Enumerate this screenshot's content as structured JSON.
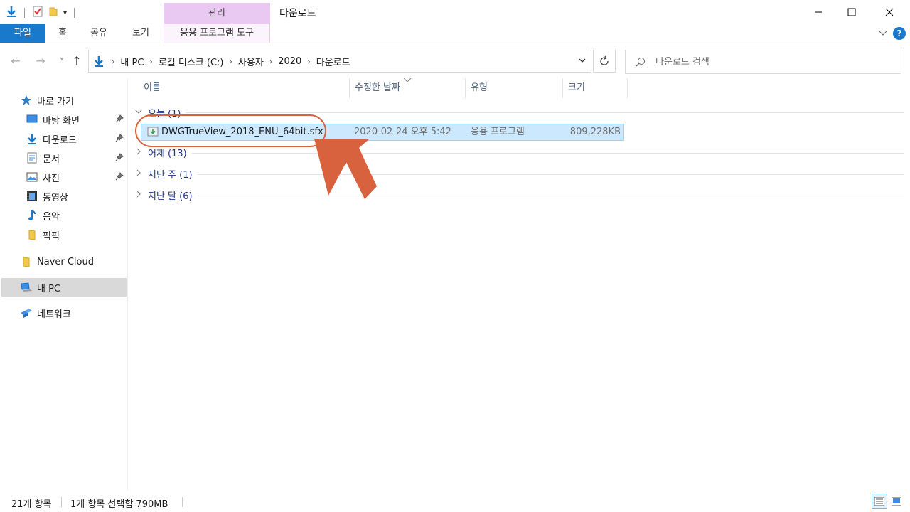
{
  "window": {
    "title": "다운로드",
    "context_tab_label": "관리"
  },
  "ribbon": {
    "tabs": [
      "파일",
      "홈",
      "공유",
      "보기",
      "응용 프로그램 도구"
    ],
    "help_label": "?"
  },
  "address": {
    "crumbs": [
      "내 PC",
      "로컬 디스크 (C:)",
      "사용자",
      "2020",
      "다운로드"
    ]
  },
  "search": {
    "placeholder": "다운로드 검색"
  },
  "sidebar": {
    "quick_access": "바로 가기",
    "items": [
      {
        "label": "바탕 화면",
        "icon": "desktop-icon",
        "pinned": true
      },
      {
        "label": "다운로드",
        "icon": "download-icon",
        "pinned": true
      },
      {
        "label": "문서",
        "icon": "document-icon",
        "pinned": true
      },
      {
        "label": "사진",
        "icon": "pictures-icon",
        "pinned": true
      },
      {
        "label": "동영상",
        "icon": "video-icon",
        "pinned": false
      },
      {
        "label": "음악",
        "icon": "music-icon",
        "pinned": false
      },
      {
        "label": "픽픽",
        "icon": "folder-icon",
        "pinned": false
      }
    ],
    "naver_cloud": "Naver Cloud",
    "this_pc": "내 PC",
    "network": "네트워크"
  },
  "columns": [
    "이름",
    "수정한 날짜",
    "유형",
    "크기"
  ],
  "groups": [
    {
      "label": "오늘 (1)",
      "expanded": true
    },
    {
      "label": "어제 (13)",
      "expanded": false
    },
    {
      "label": "지난 주 (1)",
      "expanded": false
    },
    {
      "label": "지난 달 (6)",
      "expanded": false
    }
  ],
  "file": {
    "name": "DWGTrueView_2018_ENU_64bit.sfx",
    "modified": "2020-02-24 오후 5:42",
    "type": "응용 프로그램",
    "size": "809,228KB"
  },
  "status": {
    "count": "21개 항목",
    "selection": "1개 항목 선택함 790MB"
  },
  "colors": {
    "file_tab": "#1979ca",
    "context_tab": "#e9c9f2",
    "selection": "#cce8ff",
    "annotation": "#d9623e"
  }
}
